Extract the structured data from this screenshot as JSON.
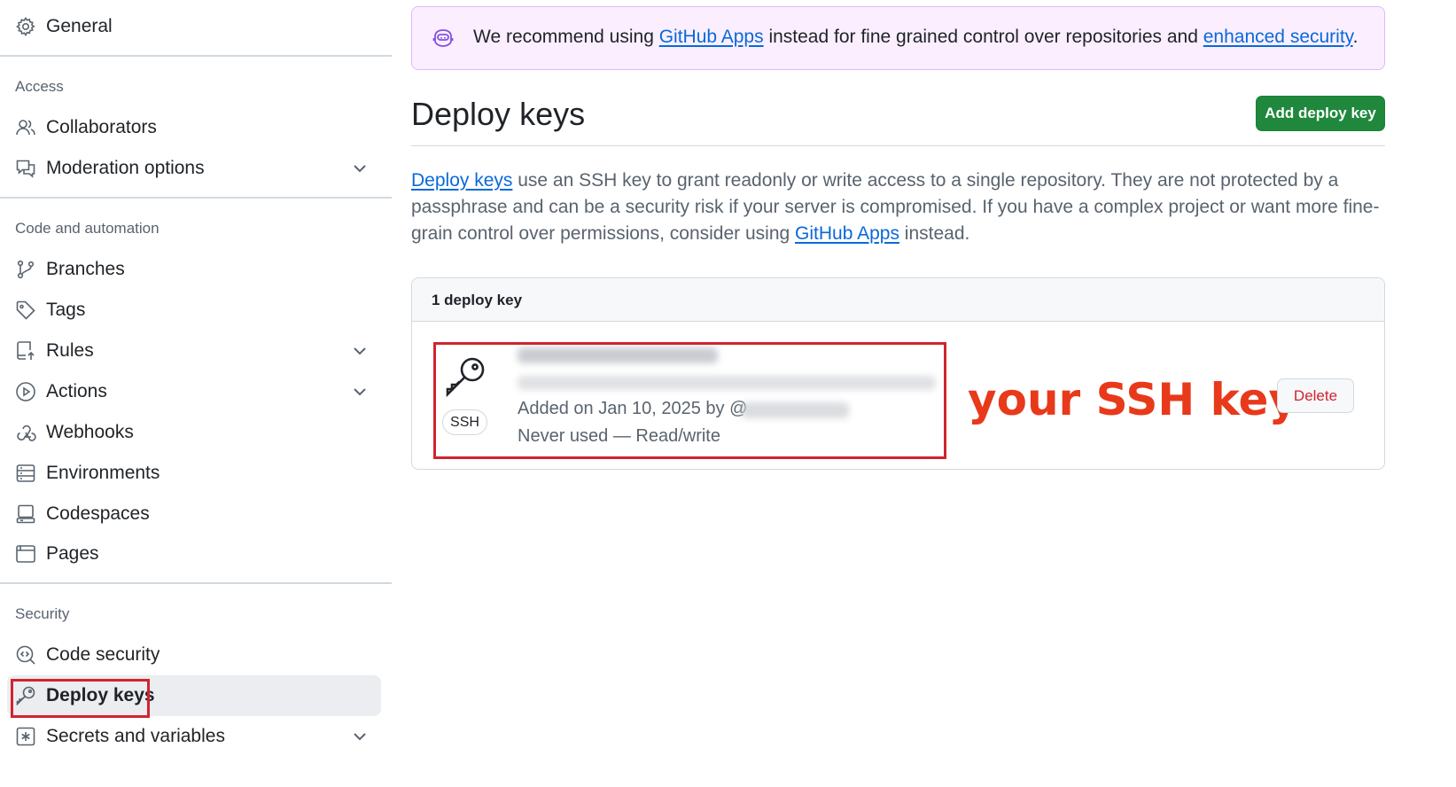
{
  "sidebar": {
    "general": "General",
    "sections": {
      "access": "Access",
      "code_automation": "Code and automation",
      "security": "Security"
    },
    "items": {
      "collaborators": "Collaborators",
      "moderation": "Moderation options",
      "branches": "Branches",
      "tags": "Tags",
      "rules": "Rules",
      "actions": "Actions",
      "webhooks": "Webhooks",
      "environments": "Environments",
      "codespaces": "Codespaces",
      "pages": "Pages",
      "code_security": "Code security",
      "deploy_keys": "Deploy keys",
      "secrets": "Secrets and variables"
    }
  },
  "banner": {
    "prefix": "We recommend using ",
    "link1": "GitHub Apps",
    "middle": " instead for fine grained control over repositories and ",
    "link2": "enhanced security",
    "suffix": "."
  },
  "main": {
    "title": "Deploy keys",
    "add_button": "Add deploy key",
    "desc_link1": "Deploy keys",
    "desc_part1": " use an SSH key to grant readonly or write access to a single repository. They are not protected by a passphrase and can be a security risk if your server is compromised. If you have a complex project or want more fine-grain control over permissions, consider using ",
    "desc_link2": "GitHub Apps",
    "desc_part2": " instead."
  },
  "keys": {
    "count": "1 deploy key",
    "badge": "SSH",
    "added": "Added on Jan 10, 2025 by @",
    "used": "Never used — Read/write",
    "delete": "Delete"
  },
  "annotation": "your SSH key",
  "colors": {
    "accent_link": "#0969da",
    "primary_button": "#1f883d",
    "danger": "#d1242f",
    "annotation": "#e8391b",
    "banner_bg": "#fbefff"
  },
  "icons": {
    "general": "gear-icon",
    "collaborators": "people-icon",
    "moderation": "comment-discussion-icon",
    "branches": "git-branch-icon",
    "tags": "tag-icon",
    "rules": "repo-push-icon",
    "actions": "play-icon",
    "webhooks": "webhook-icon",
    "environments": "server-icon",
    "codespaces": "codespaces-icon",
    "pages": "browser-icon",
    "code_security": "codescan-icon",
    "deploy_keys": "key-icon",
    "secrets": "asterisk-icon",
    "banner": "copilot-icon"
  }
}
